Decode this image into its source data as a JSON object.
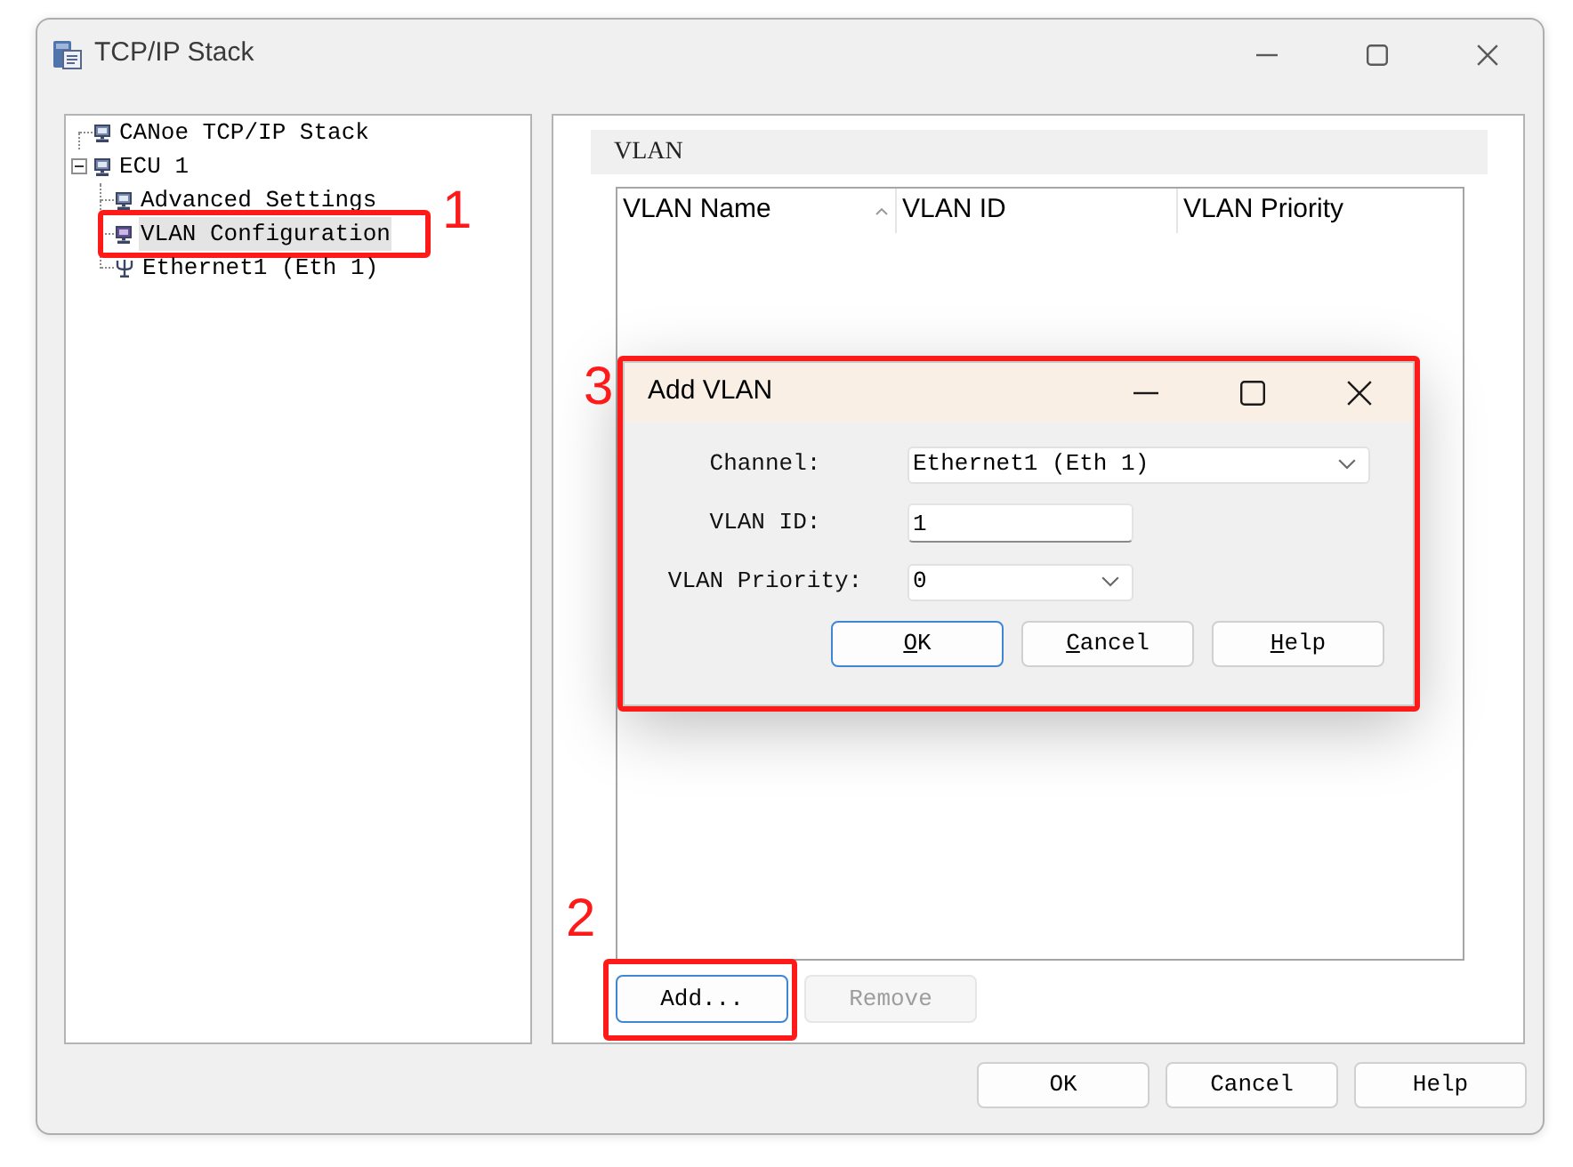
{
  "window": {
    "title": "TCP/IP Stack"
  },
  "tree": [
    {
      "label": "CANoe TCP/IP Stack",
      "kind": "node",
      "selected": false
    },
    {
      "label": "ECU 1",
      "kind": "node",
      "selected": false,
      "expanded": true,
      "children": [
        {
          "label": "Advanced Settings",
          "kind": "node",
          "selected": false
        },
        {
          "label": "VLAN Configuration",
          "kind": "node",
          "selected": true,
          "callout": "1"
        },
        {
          "label": "Ethernet1 (Eth 1)",
          "kind": "channel",
          "selected": false
        }
      ]
    }
  ],
  "vlan_panel": {
    "title": "VLAN",
    "columns": [
      {
        "label": "VLAN Name",
        "sorted": true
      },
      {
        "label": "VLAN ID",
        "sorted": false
      },
      {
        "label": "VLAN Priority",
        "sorted": false
      }
    ],
    "buttons": [
      {
        "label": "Add...",
        "focused": true,
        "disabled": false,
        "callout": "2"
      },
      {
        "label": "Remove",
        "focused": false,
        "disabled": true
      }
    ]
  },
  "dialog": {
    "title": "Add VLAN",
    "callout": "3",
    "fields": [
      {
        "label": "Channel:",
        "kind": "dropdown",
        "value": "Ethernet1 (Eth 1)"
      },
      {
        "label": "VLAN ID:",
        "kind": "text",
        "value": "1"
      },
      {
        "label": "VLAN Priority:",
        "kind": "dropdown",
        "value": "0"
      }
    ],
    "buttons": [
      {
        "label": "OK",
        "focused": true,
        "mnemonic": true
      },
      {
        "label": "Cancel",
        "focused": false,
        "mnemonic": true
      },
      {
        "label": "Help",
        "focused": false,
        "mnemonic": true
      }
    ]
  },
  "buttons": [
    {
      "label": "OK",
      "focused": false
    },
    {
      "label": "Cancel",
      "focused": false
    },
    {
      "label": "Help",
      "focused": false
    }
  ]
}
